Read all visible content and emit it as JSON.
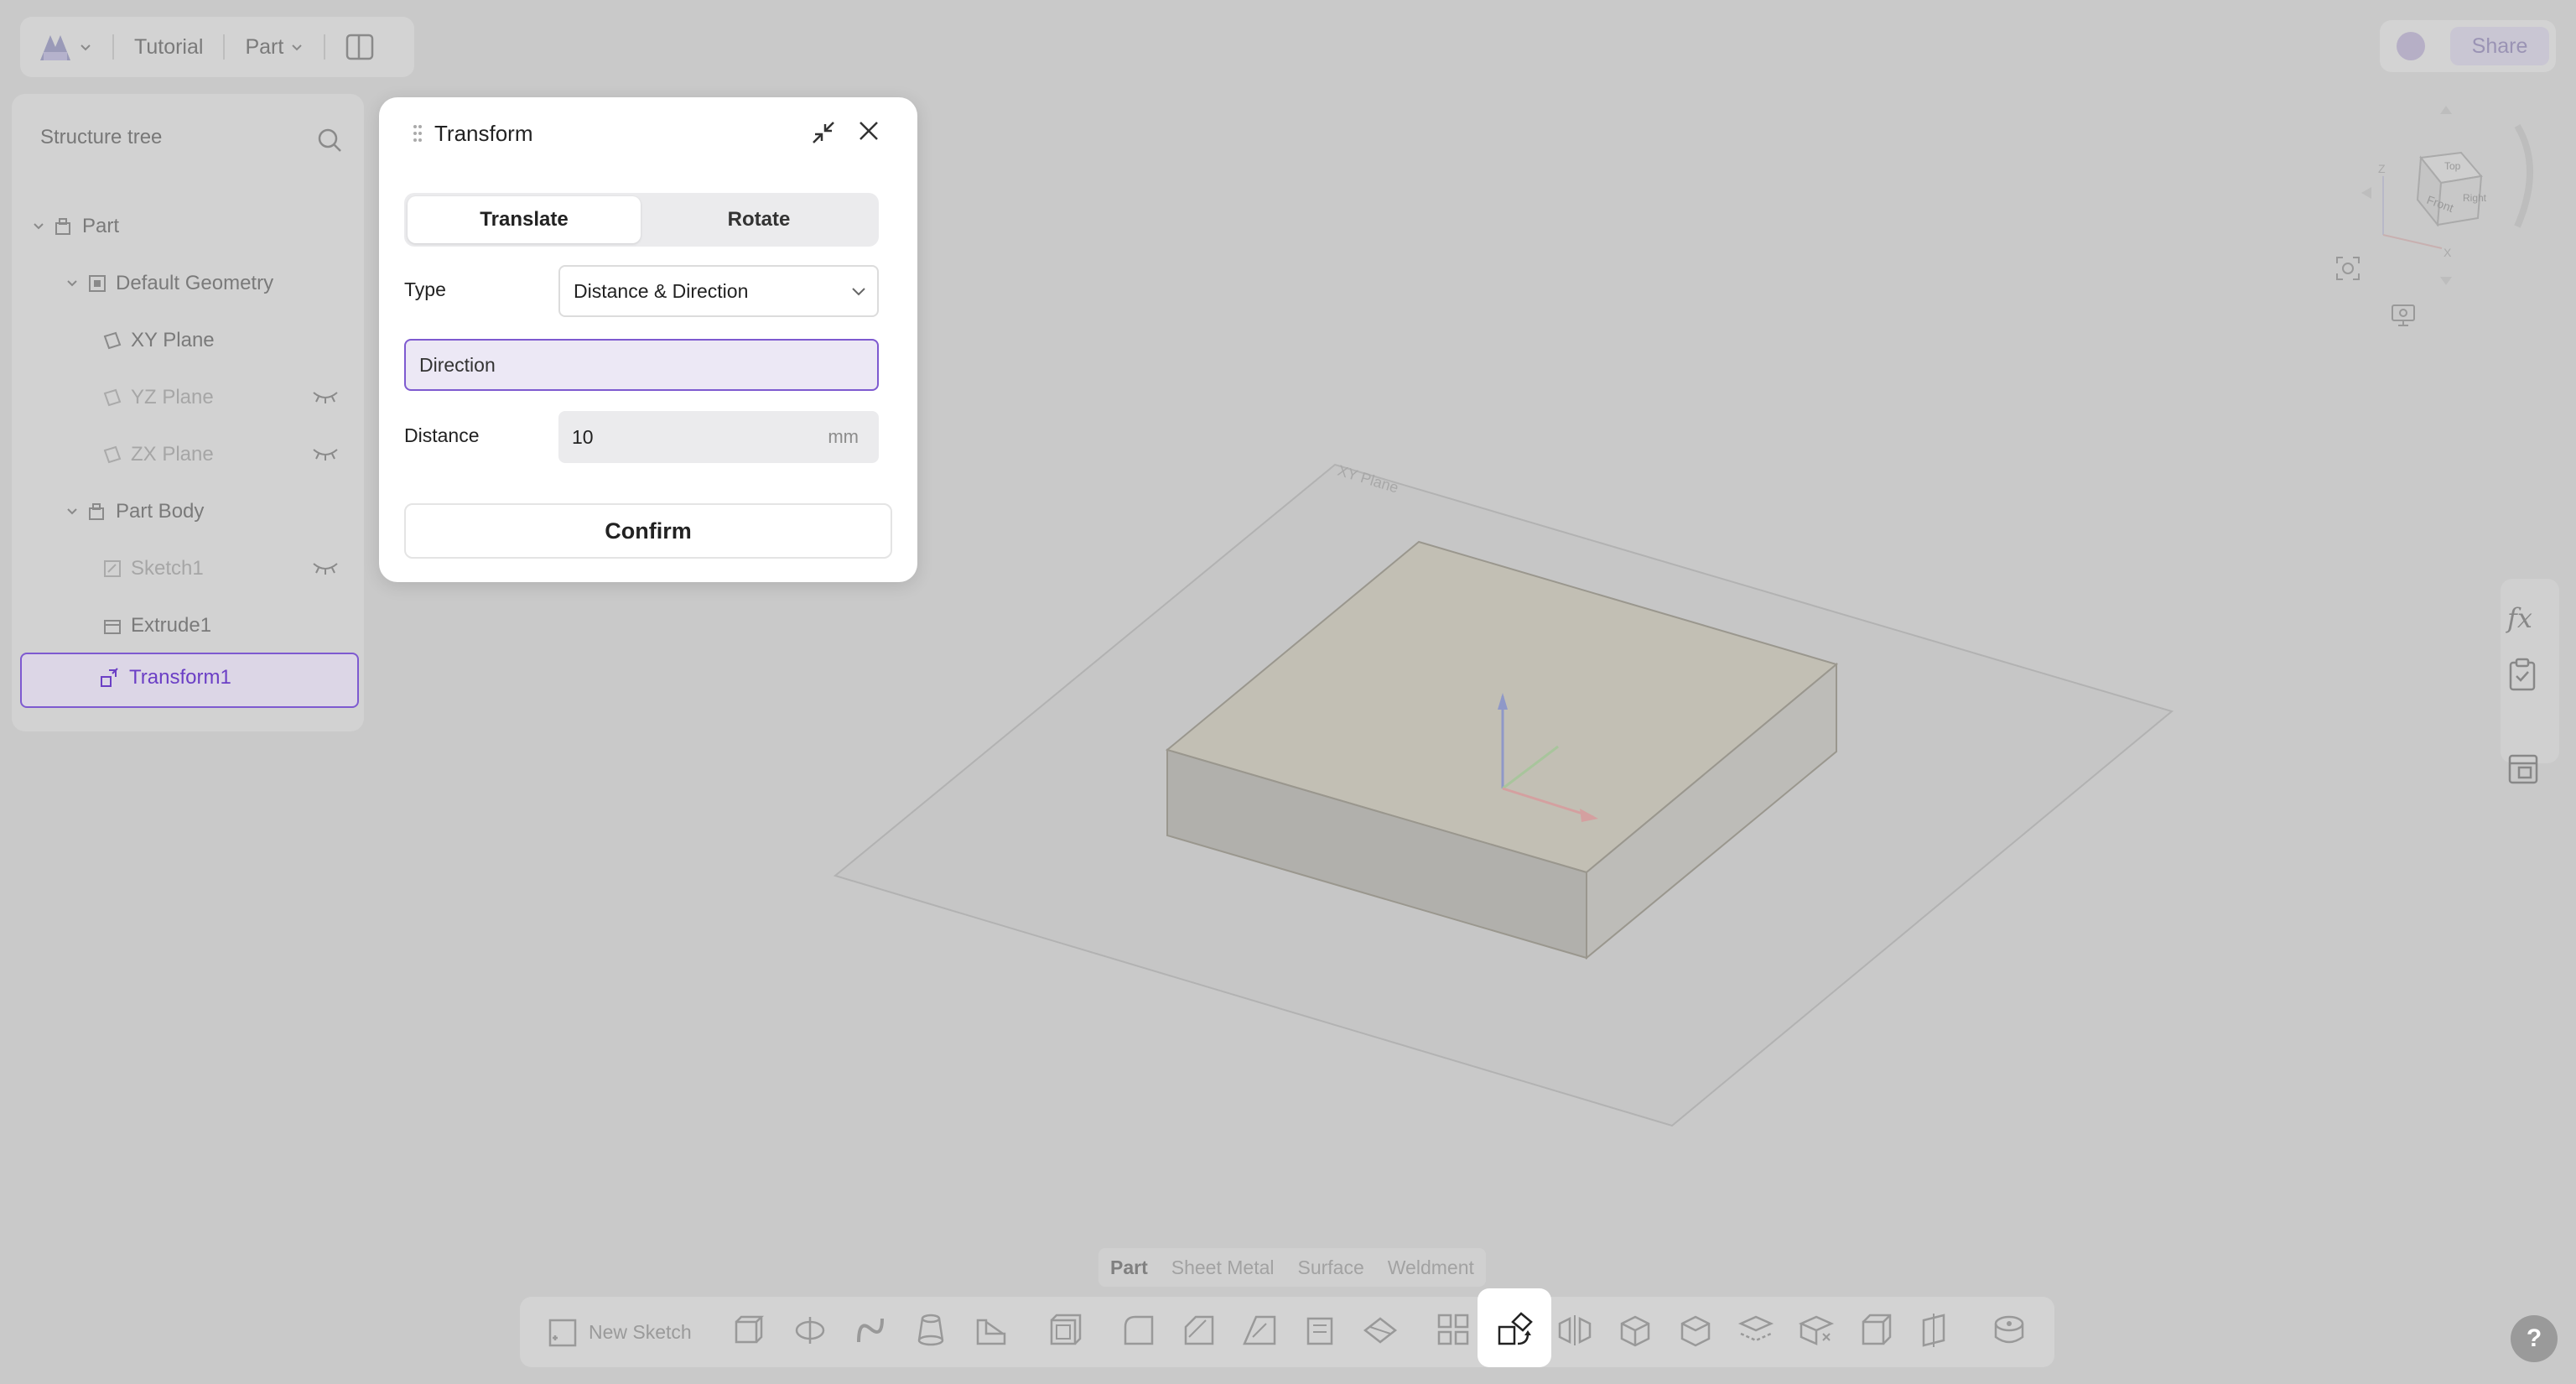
{
  "topbar": {
    "project": "Tutorial",
    "mode": "Part",
    "share": "Share"
  },
  "sidebar": {
    "title": "Structure tree",
    "items": [
      {
        "label": "Part"
      },
      {
        "label": "Default Geometry"
      },
      {
        "label": "XY Plane"
      },
      {
        "label": "YZ Plane"
      },
      {
        "label": "ZX Plane"
      },
      {
        "label": "Part Body"
      },
      {
        "label": "Sketch1"
      },
      {
        "label": "Extrude1"
      },
      {
        "label": "Transform1"
      }
    ]
  },
  "dialog": {
    "title": "Transform",
    "tabs": [
      "Translate",
      "Rotate"
    ],
    "type_label": "Type",
    "type_value": "Distance & Direction",
    "direction_placeholder": "Direction",
    "distance_label": "Distance",
    "distance_value": "10",
    "distance_unit": "mm",
    "confirm": "Confirm"
  },
  "viewport": {
    "plane_label": "XY Plane"
  },
  "cube_faces": [
    "Top",
    "Front",
    "Right"
  ],
  "cube_axes": [
    "Z",
    "X"
  ],
  "mode_tabs": [
    "Part",
    "Sheet Metal",
    "Surface",
    "Weldment"
  ],
  "toolbar": {
    "new_sketch": "New Sketch"
  },
  "help": "?"
}
